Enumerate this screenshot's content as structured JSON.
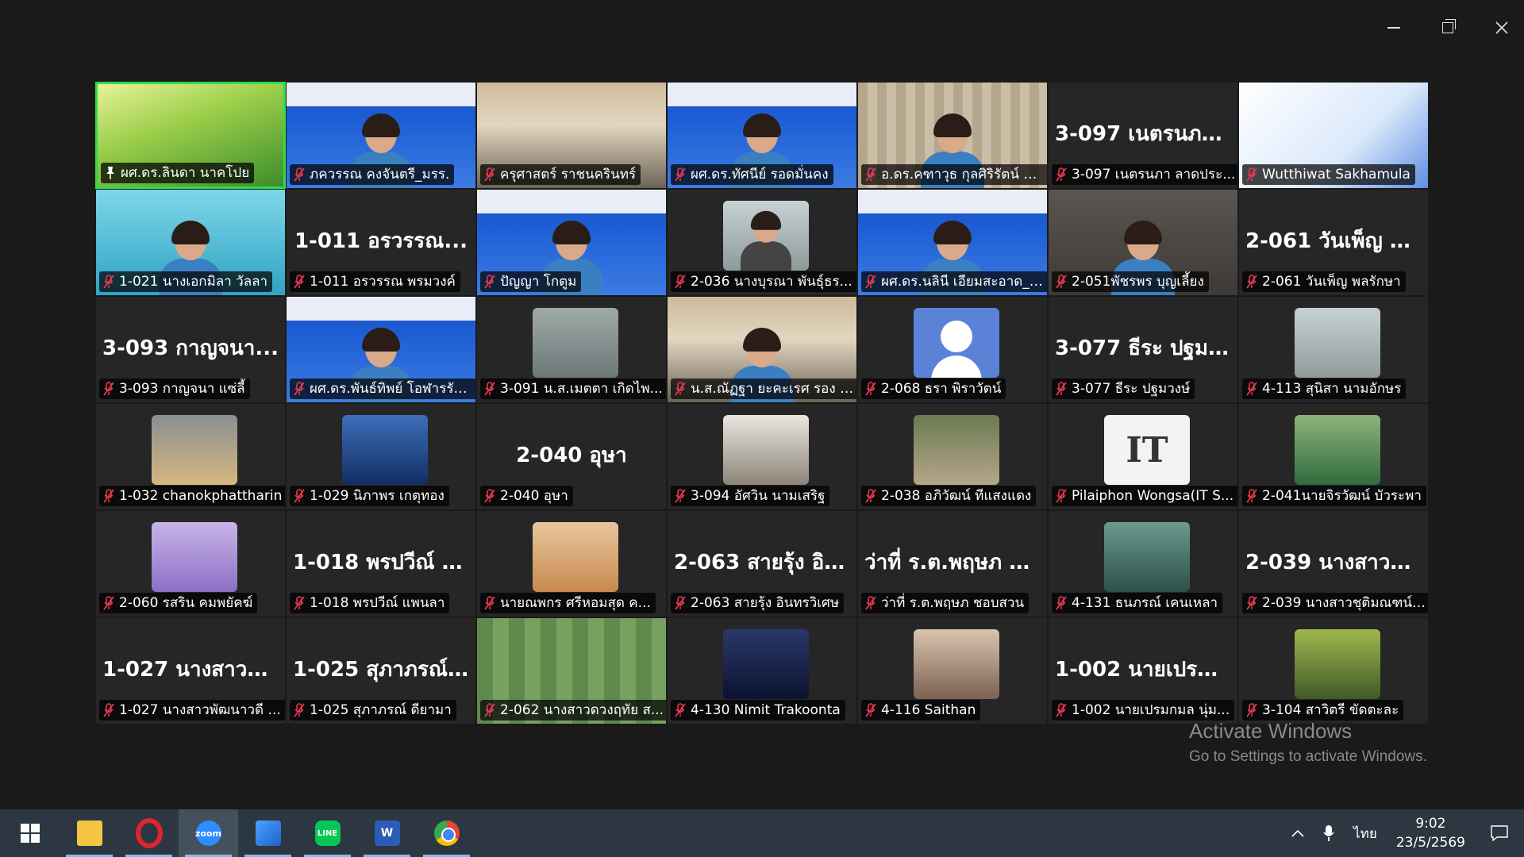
{
  "participants": [
    {
      "label": "ผศ.ดร.ลินดา นาคโปย",
      "bigname": "",
      "bg": "bg-green",
      "thumb": "",
      "active": true,
      "pin": true
    },
    {
      "label": "ภควรรณ คงจันตรี_มรร.",
      "bigname": "",
      "bg": "bg-poster-blue",
      "thumb": "person"
    },
    {
      "label": "ครุศาสตร์ ราชนครินทร์",
      "bigname": "",
      "bg": "bg-room",
      "thumb": ""
    },
    {
      "label": "ผศ.ดร.ทัศนีย์ รอดมั่นคง",
      "bigname": "",
      "bg": "bg-poster-blue",
      "thumb": "person"
    },
    {
      "label": "อ.ดร.คฑาวุธ กุลศิริรัตน์ มรร.",
      "bigname": "",
      "bg": "bg-curtain",
      "thumb": "person"
    },
    {
      "label": "3-097 เนตรนภา ลาดประ...",
      "bigname": "3-097 เนตรนภา...",
      "bg": "bg-dark",
      "thumb": ""
    },
    {
      "label": "Wutthiwat Sakhamula",
      "bigname": "",
      "bg": "bg-white-poster",
      "thumb": ""
    },
    {
      "label": "1-021 นางเอกมิลา วัลลา",
      "bigname": "",
      "bg": "bg-cyan",
      "thumb": "person"
    },
    {
      "label": "1-011 อรวรรณ พรมวงค์",
      "bigname": "1-011 อรวรรณ...",
      "bg": "bg-dark",
      "thumb": ""
    },
    {
      "label": "ปัญญา โกตูม",
      "bigname": "",
      "bg": "bg-poster-blue",
      "thumb": "person"
    },
    {
      "label": "2-036 นางบุรณา พันธุ์ธร...",
      "bigname": "",
      "bg": "bg-dark",
      "thumb": "face"
    },
    {
      "label": "ผศ.ดร.นลินี เอียมสะอาด_ม...",
      "bigname": "",
      "bg": "bg-poster-blue",
      "thumb": "person"
    },
    {
      "label": "2-051พัชรพร บุญเลี้ยง",
      "bigname": "",
      "bg": "bg-dim",
      "thumb": "person"
    },
    {
      "label": "2-061 วันเพ็ญ พลรักษา",
      "bigname": "2-061 วันเพ็ญ พ...",
      "bg": "bg-dark",
      "thumb": ""
    },
    {
      "label": "3-093 กาญจนา แซ่ลี้",
      "bigname": "3-093 กาญจนา...",
      "bg": "bg-dark",
      "thumb": ""
    },
    {
      "label": "ผศ.ดร.พันธ์ทิพย์ โอฬารรัต...",
      "bigname": "",
      "bg": "bg-poster-blue",
      "thumb": "person"
    },
    {
      "label": "3-091 น.ส.เมตตา เกิดไพ...",
      "bigname": "",
      "bg": "bg-dark",
      "thumb": "thumb-grey"
    },
    {
      "label": "น.ส.ณัฏฐา ยะคะเรศ รอง ผ...",
      "bigname": "",
      "bg": "bg-room",
      "thumb": "person"
    },
    {
      "label": "2-068 ธรา พิราวัตน์",
      "bigname": "",
      "bg": "bg-dark",
      "thumb": "avatar"
    },
    {
      "label": "3-077 ธีระ ปฐมวงษ์",
      "bigname": "3-077 ธีระ ปฐม...",
      "bg": "bg-dark",
      "thumb": ""
    },
    {
      "label": "4-113 สุนิสา นามอักษร",
      "bigname": "",
      "bg": "bg-dark",
      "thumb": "thumb-face"
    },
    {
      "label": "1-032 chanokphattharin",
      "bigname": "",
      "bg": "bg-dark",
      "thumb": "thumb-dog"
    },
    {
      "label": "1-029 นิภาพร เกตุทอง",
      "bigname": "",
      "bg": "bg-dark",
      "thumb": "thumb-grad"
    },
    {
      "label": "2-040 อุษา",
      "bigname": "2-040 อุษา",
      "bg": "bg-dark",
      "thumb": ""
    },
    {
      "label": "3-094 อัศวิน นามเสริฐ",
      "bigname": "",
      "bg": "bg-dark",
      "thumb": "thumb-cam"
    },
    {
      "label": "2-038 อภิวัฒน์ ทีแสงแดง",
      "bigname": "",
      "bg": "bg-dark",
      "thumb": "thumb-garden"
    },
    {
      "label": "Pilaiphon Wongsa(IT S...",
      "bigname": "",
      "bg": "bg-dark",
      "thumb": "it"
    },
    {
      "label": "2-041นายจิรวัฒน์ บัวระพา",
      "bigname": "",
      "bg": "bg-dark",
      "thumb": "thumb-field"
    },
    {
      "label": "2-060 รสริน คมพยัคฆ์",
      "bigname": "",
      "bg": "bg-dark",
      "thumb": "thumb-girl"
    },
    {
      "label": "1-018 พรปวีณ์ แพนลา",
      "bigname": "1-018 พรปวีณ์ แ...",
      "bg": "bg-dark",
      "thumb": ""
    },
    {
      "label": "นายณพกร ศรีหอมสุด ค...",
      "bigname": "",
      "bg": "bg-dark",
      "thumb": "thumb-cat"
    },
    {
      "label": "2-063 สายรุ้ง อินทรวิเศษ",
      "bigname": "2-063 สายรุ้ง อิน...",
      "bg": "bg-dark",
      "thumb": ""
    },
    {
      "label": "ว่าที่ ร.ต.พฤษภ ชอบสวน",
      "bigname": "ว่าที่ ร.ต.พฤษภ ช...",
      "bg": "bg-dark",
      "thumb": ""
    },
    {
      "label": "4-131 ธนภรณ์ เคนเหลา",
      "bigname": "",
      "bg": "bg-dark",
      "thumb": "thumb-water"
    },
    {
      "label": "2-039 นางสาวชุติมณฑน์ ...",
      "bigname": "2-039 นางสาวชุ...",
      "bg": "bg-dark",
      "thumb": ""
    },
    {
      "label": "1-027 นางสาวพัฒนาวดี ...",
      "bigname": "1-027 นางสาวพั...",
      "bg": "bg-dark",
      "thumb": ""
    },
    {
      "label": "1-025 สุภาภรณ์ ดียามา",
      "bigname": "1-025 สุภาภรณ์...",
      "bg": "bg-dark",
      "thumb": ""
    },
    {
      "label": "2-062 นางสาวดวงฤทัย ส...",
      "bigname": "",
      "bg": "bg-green-curtain",
      "thumb": ""
    },
    {
      "label": "4-130 Nimit Trakoonta",
      "bigname": "",
      "bg": "bg-dark",
      "thumb": "thumb-night"
    },
    {
      "label": "4-116 Saithan",
      "bigname": "",
      "bg": "bg-dark",
      "thumb": "thumb-party"
    },
    {
      "label": "1-002 นายเปรมกมล นุ่ม...",
      "bigname": "1-002 นายเปรม...",
      "bg": "bg-dark",
      "thumb": ""
    },
    {
      "label": "3-104 สาวิตรี ขัดตะละ",
      "bigname": "",
      "bg": "bg-dark",
      "thumb": "thumb-yellow"
    }
  ],
  "watermark": {
    "line1": "Activate Windows",
    "line2": "Go to Settings to activate Windows."
  },
  "taskbar": {
    "apps": [
      {
        "name": "windows-start-button",
        "icon": "windows-icon"
      },
      {
        "name": "file-explorer",
        "icon": "folder-icon",
        "open": true
      },
      {
        "name": "opera-browser",
        "icon": "opera-icon",
        "open": true
      },
      {
        "name": "zoom-app",
        "icon": "zoom-icon",
        "open": true,
        "active": true
      },
      {
        "name": "maps-app",
        "icon": "maps-icon",
        "open": true
      },
      {
        "name": "line-app",
        "icon": "line-icon",
        "open": true
      },
      {
        "name": "word-app",
        "icon": "word-icon",
        "open": true
      },
      {
        "name": "chrome-browser",
        "icon": "chrome-icon",
        "open": true
      }
    ],
    "zoom_icon_text": "zoom",
    "line_icon_text": "LINE",
    "language": "ไทย",
    "time": "9:02",
    "date": "23/5/2569"
  },
  "colors": {
    "active_speaker_border": "#2fdb4c",
    "muted_mic": "#e8384f",
    "taskbar_bg": "#2c3742",
    "window_bg": "#1a1a1a"
  }
}
